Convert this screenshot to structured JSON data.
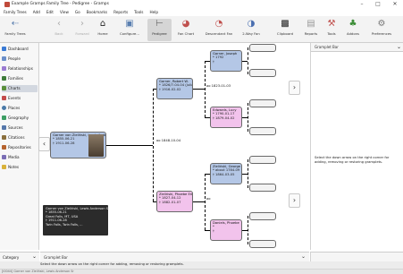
{
  "window": {
    "title": "Example Gramps Family Tree - Pedigree - Gramps",
    "minimize": "–",
    "maximize": "□",
    "close": "✕"
  },
  "menu": [
    "Family Trees",
    "Add",
    "Edit",
    "View",
    "Go",
    "Bookmarks",
    "Reports",
    "Tools",
    "Help"
  ],
  "toolbar": {
    "family_trees": "Family Trees",
    "back": "Back",
    "forward": "Forward",
    "home": "Home",
    "configure": "Configure...",
    "pedigree": "Pedigree",
    "fan_chart": "Fan Chart",
    "descendant_fan": "Descendant Fan",
    "two_way_fan": "2-Way Fan",
    "clipboard": "Clipboard",
    "reports": "Reports",
    "tools": "Tools",
    "addons": "Addons",
    "preferences": "Preferences"
  },
  "sidebar": {
    "items": [
      {
        "label": "Dashboard",
        "color": "#3a7bd5"
      },
      {
        "label": "People",
        "color": "#6b8fc9"
      },
      {
        "label": "Relationships",
        "color": "#9b7bd1"
      },
      {
        "label": "Families",
        "color": "#3f7c3a"
      },
      {
        "label": "Charts",
        "color": "#5a8f3a"
      },
      {
        "label": "Events",
        "color": "#c44b4b"
      },
      {
        "label": "Places",
        "color": "#4a7aa8"
      },
      {
        "label": "Geography",
        "color": "#3c9e63"
      },
      {
        "label": "Sources",
        "color": "#5577aa"
      },
      {
        "label": "Citations",
        "color": "#8a6f3d"
      },
      {
        "label": "Repositories",
        "color": "#b5632e"
      },
      {
        "label": "Media",
        "color": "#7a6db5"
      },
      {
        "label": "Notes",
        "color": "#d9b23a"
      }
    ],
    "category_label": "Category"
  },
  "pedigree": {
    "active": {
      "name": "Garner von Zieliński, Lewis Anderson Sr",
      "birth": "* 1855-06-21",
      "death": "† 1911-06-28"
    },
    "father": {
      "name": "Garner, Robert W.",
      "birth": "* 1826/7-04-04 (Julian)",
      "death": "† 1916-02-02"
    },
    "mother": {
      "name": "Zieliński, Phoebe Emily",
      "birth": "* 1827-04-12",
      "death": "† 1882-01-07"
    },
    "pgf": {
      "name": "Garner, Joseph",
      "birth": "* 1792",
      "death": "†"
    },
    "pgm": {
      "name": "Edwards, Lucy",
      "birth": "* 1790-01-17",
      "death": "† 1879-04-02"
    },
    "mgf": {
      "name": "Zieliński, George",
      "birth": "* about 1784-09",
      "death": "† 1864-03-05"
    },
    "mgm": {
      "name": "Daniels, Phoebe",
      "birth": "*",
      "death": "†"
    },
    "marriages": {
      "parents": "oo 1848-10-04",
      "paternal": "oo 1823-01-03",
      "maternal": "oo"
    },
    "tooltip": [
      "Garner von Zieliński, Lewis Anderson Sr",
      "* 1855-06-21",
      "  Great Falls, MT, USA",
      "† 1911-06-28",
      "  Twin Falls, Twin Falls, ..."
    ]
  },
  "gramplets": {
    "right_tab": "Gramplet Bar",
    "bottom_tab": "Gramplet Bar",
    "message": "Select the down arrow on the right corner for adding, removing or restoring gramplets."
  },
  "status": {
    "message": "Select the down arrow on the right corner for adding, removing or restoring gramplets.",
    "active_person": "[I0044] Garner von Zieliński, Lewis Anderson Sr"
  }
}
